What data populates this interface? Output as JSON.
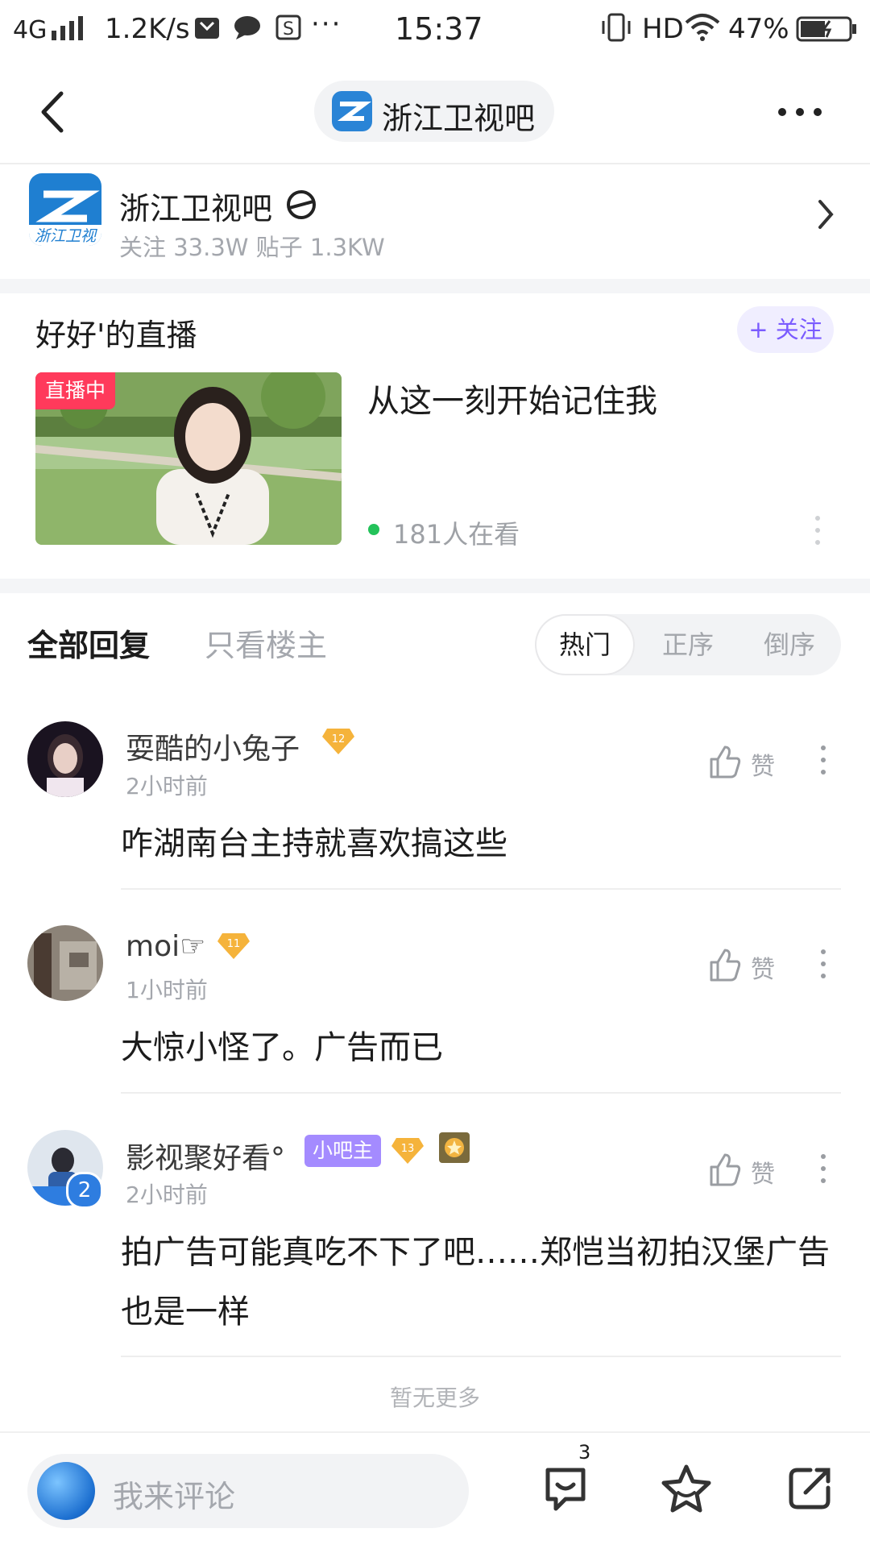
{
  "status_bar": {
    "network": "4G",
    "speed": "1.2K/s",
    "time": "15:37",
    "hd": "HD",
    "battery": "47%"
  },
  "nav": {
    "title": "浙江卫视吧"
  },
  "forum": {
    "name": "浙江卫视吧",
    "stats": "关注 33.3W   贴子 1.3KW",
    "logo_text": "浙江卫视"
  },
  "live": {
    "streamer": "好好'的直播",
    "follow_label": "+ 关注",
    "tag": "直播中",
    "headline": "从这一刻开始记住我",
    "viewers": "181人在看"
  },
  "reply_tabs": {
    "all": "全部回复",
    "op_only": "只看楼主",
    "sort": [
      "热门",
      "正序",
      "倒序"
    ],
    "active_sort": "热门"
  },
  "comments": [
    {
      "user": "耍酷的小兔子",
      "level": "12",
      "time": "2小时前",
      "text": "咋湖南台主持就喜欢搞这些",
      "like_label": "赞"
    },
    {
      "user": "moi☞",
      "level": "11",
      "time": "1小时前",
      "text": "大惊小怪了。广告而已",
      "like_label": "赞"
    },
    {
      "user": "影视聚好看°",
      "mod_badge": "小吧主",
      "level": "13",
      "avatar_badge": "2",
      "time": "2小时前",
      "text": "拍广告可能真吃不下了吧……郑恺当初拍汉堡广告也是一样",
      "like_label": "赞"
    }
  ],
  "no_more": "暂无更多",
  "bottom": {
    "placeholder": "我来评论",
    "reply_count": "3"
  },
  "colors": {
    "accent": "#7a5bff",
    "live_red": "#ff3a5b",
    "online_green": "#23c25a",
    "mod_purple": "#a48bff",
    "level_gold": "#f5b33b"
  }
}
